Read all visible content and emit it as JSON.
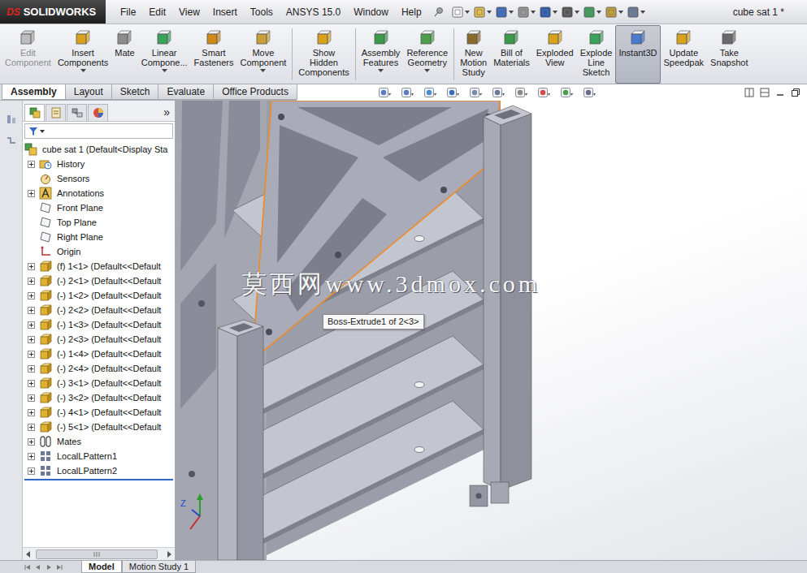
{
  "window": {
    "title": "cube sat 1 *",
    "brand": "SOLIDWORKS",
    "brand_mark": "DS"
  },
  "menu": [
    "File",
    "Edit",
    "View",
    "Insert",
    "Tools",
    "ANSYS 15.0",
    "Window",
    "Help"
  ],
  "command_manager": {
    "groups": [
      [
        {
          "label": "Edit Component",
          "disabled": true,
          "selected": false,
          "dropdown": false
        },
        {
          "label": "Insert Components",
          "disabled": false,
          "selected": false,
          "dropdown": true
        },
        {
          "label": "Mate",
          "disabled": false,
          "selected": false,
          "dropdown": false
        },
        {
          "label": "Linear Compone...",
          "disabled": false,
          "selected": false,
          "dropdown": true
        },
        {
          "label": "Smart Fasteners",
          "disabled": false,
          "selected": false,
          "dropdown": false
        },
        {
          "label": "Move Component",
          "disabled": false,
          "selected": false,
          "dropdown": true
        }
      ],
      [
        {
          "label": "Show Hidden Components",
          "disabled": false,
          "selected": false,
          "dropdown": false
        }
      ],
      [
        {
          "label": "Assembly Features",
          "disabled": false,
          "selected": false,
          "dropdown": true
        },
        {
          "label": "Reference Geometry",
          "disabled": false,
          "selected": false,
          "dropdown": true
        }
      ],
      [
        {
          "label": "New Motion Study",
          "disabled": false,
          "selected": false,
          "dropdown": false
        },
        {
          "label": "Bill of Materials",
          "disabled": false,
          "selected": false,
          "dropdown": false
        },
        {
          "label": "Exploded View",
          "disabled": false,
          "selected": false,
          "dropdown": false
        },
        {
          "label": "Explode Line Sketch",
          "disabled": false,
          "selected": false,
          "dropdown": false
        },
        {
          "label": "Instant3D",
          "disabled": false,
          "selected": true,
          "dropdown": false
        },
        {
          "label": "Update Speedpak",
          "disabled": false,
          "selected": false,
          "dropdown": false
        },
        {
          "label": "Take Snapshot",
          "disabled": false,
          "selected": false,
          "dropdown": false
        }
      ]
    ]
  },
  "tabs": [
    {
      "label": "Assembly",
      "selected": true
    },
    {
      "label": "Layout",
      "selected": false
    },
    {
      "label": "Sketch",
      "selected": false
    },
    {
      "label": "Evaluate",
      "selected": false
    },
    {
      "label": "Office Products",
      "selected": false
    }
  ],
  "feature_tree": {
    "panel_tabs": [
      {
        "kind": "features",
        "selected": true
      },
      {
        "kind": "properties",
        "selected": false
      },
      {
        "kind": "configurations",
        "selected": false
      },
      {
        "kind": "display",
        "selected": false
      }
    ],
    "more": "»",
    "root": {
      "label": "cube sat 1 (Default<Display Sta"
    },
    "items": [
      {
        "label": "History",
        "kind": "history",
        "expandable": true,
        "expanded": false
      },
      {
        "label": "Sensors",
        "kind": "sensors",
        "expandable": false,
        "expanded": false
      },
      {
        "label": "Annotations",
        "kind": "annotations",
        "expandable": true,
        "expanded": false
      },
      {
        "label": "Front Plane",
        "kind": "plane",
        "expandable": false,
        "expanded": false
      },
      {
        "label": "Top Plane",
        "kind": "plane",
        "expandable": false,
        "expanded": false
      },
      {
        "label": "Right Plane",
        "kind": "plane",
        "expandable": false,
        "expanded": false
      },
      {
        "label": "Origin",
        "kind": "origin",
        "expandable": false,
        "expanded": false
      },
      {
        "label": "(f) 1<1> (Default<<Default",
        "kind": "part",
        "expandable": true,
        "expanded": false
      },
      {
        "label": "(-) 2<1> (Default<<Default",
        "kind": "part",
        "expandable": true,
        "expanded": false
      },
      {
        "label": "(-) 1<2> (Default<<Default",
        "kind": "part",
        "expandable": true,
        "expanded": false
      },
      {
        "label": "(-) 2<2> (Default<<Default",
        "kind": "part",
        "expandable": true,
        "expanded": false
      },
      {
        "label": "(-) 1<3> (Default<<Default",
        "kind": "part",
        "expandable": true,
        "expanded": false
      },
      {
        "label": "(-) 2<3> (Default<<Default",
        "kind": "part",
        "expandable": true,
        "expanded": false
      },
      {
        "label": "(-) 1<4> (Default<<Default",
        "kind": "part",
        "expandable": true,
        "expanded": false
      },
      {
        "label": "(-) 2<4> (Default<<Default",
        "kind": "part",
        "expandable": true,
        "expanded": false
      },
      {
        "label": "(-) 3<1> (Default<<Default",
        "kind": "part",
        "expandable": true,
        "expanded": false
      },
      {
        "label": "(-) 3<2> (Default<<Default",
        "kind": "part",
        "expandable": true,
        "expanded": false
      },
      {
        "label": "(-) 4<1> (Default<<Default",
        "kind": "part",
        "expandable": true,
        "expanded": false
      },
      {
        "label": "(-) 5<1> (Default<<Default",
        "kind": "part",
        "expandable": true,
        "expanded": false
      },
      {
        "label": "Mates",
        "kind": "mates",
        "expandable": true,
        "expanded": false
      },
      {
        "label": "LocalLPattern1",
        "kind": "pattern",
        "expandable": true,
        "expanded": false
      },
      {
        "label": "LocalLPattern2",
        "kind": "pattern",
        "expandable": true,
        "expanded": false
      }
    ]
  },
  "viewport": {
    "watermark": "莫西网www.3dmox.com",
    "tooltip": "Boss-Extrude1 of 2<3>",
    "triad_label": "Z"
  },
  "bottom_tabs": [
    {
      "label": "Model",
      "selected": true
    },
    {
      "label": "Motion Study 1",
      "selected": false
    }
  ]
}
